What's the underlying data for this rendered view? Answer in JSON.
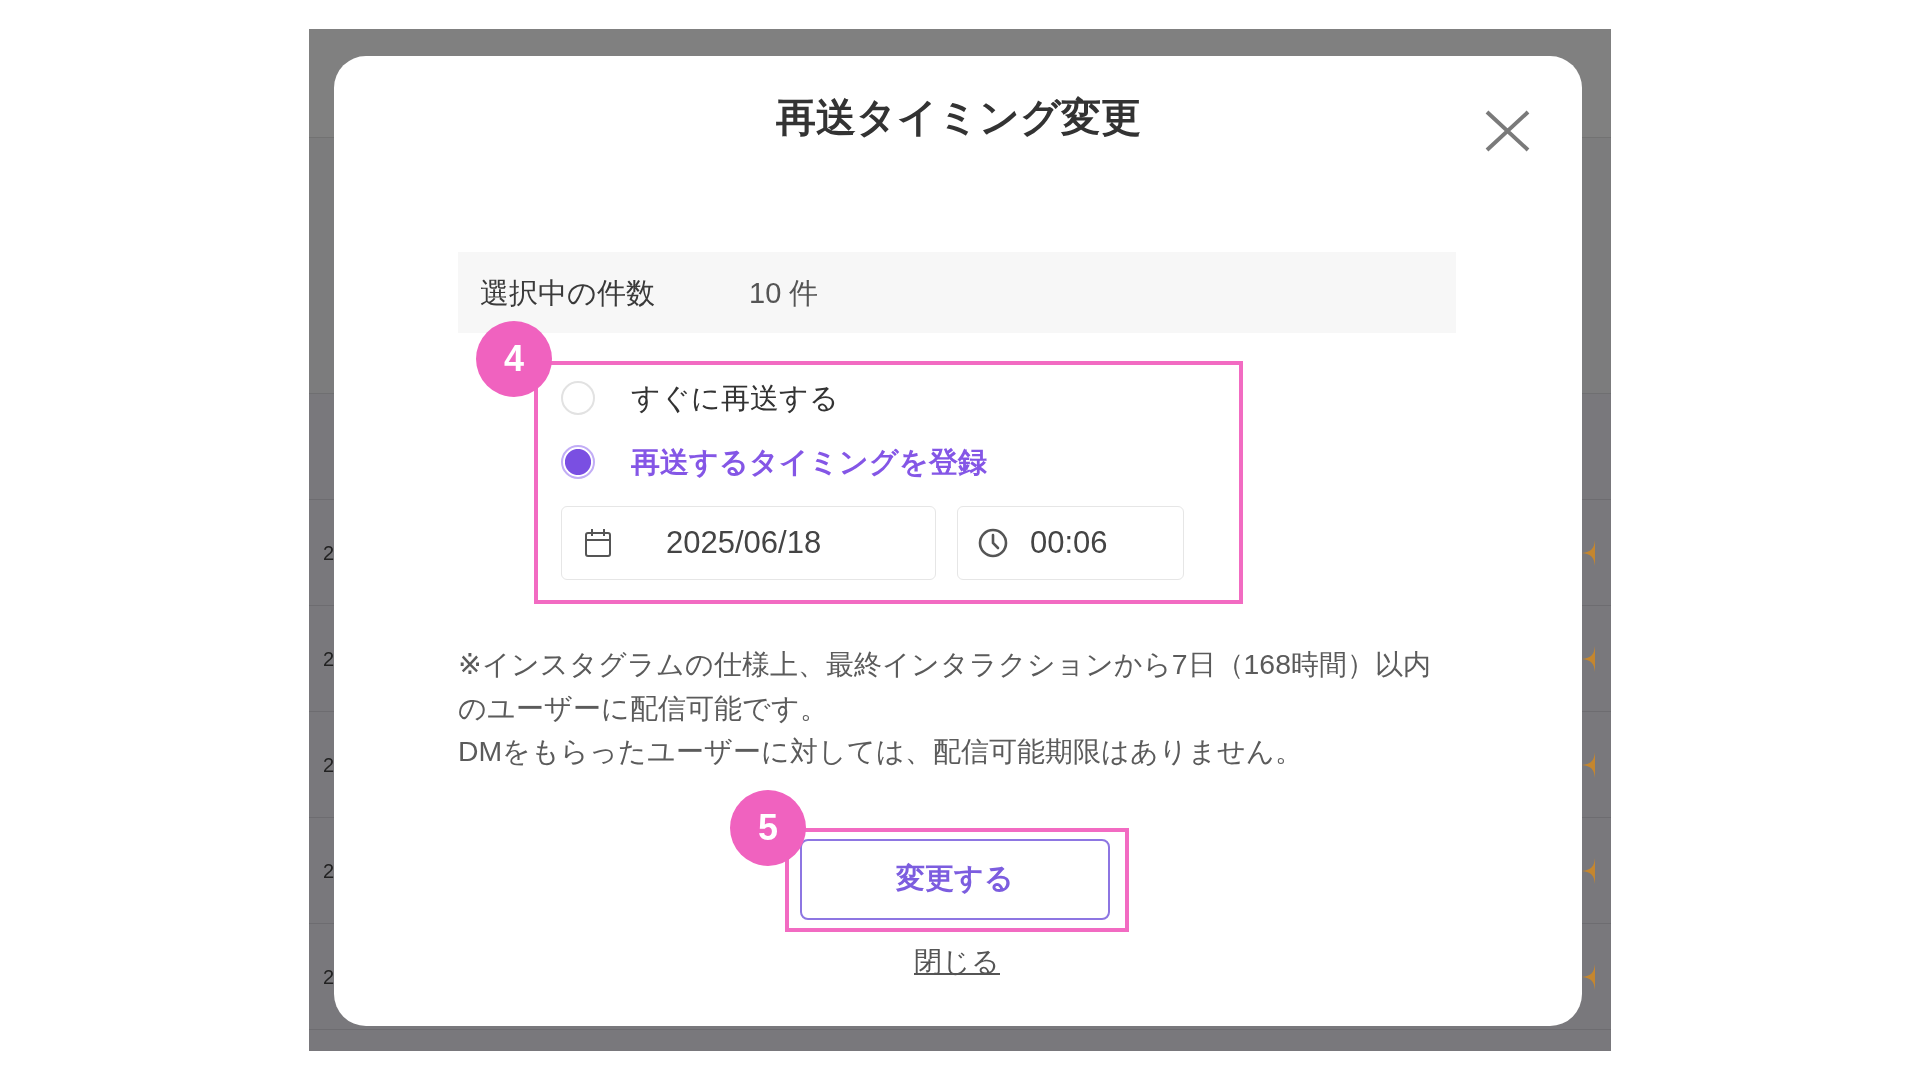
{
  "background_page": {
    "table_rows": [
      {
        "column_1": "2"
      },
      {
        "column_1": "2"
      },
      {
        "column_1": "2"
      },
      {
        "column_1": "2"
      },
      {
        "column_1": "2"
      }
    ]
  },
  "dialog": {
    "title": "再送タイミング変更",
    "selected_count": {
      "label": "選択中の件数",
      "value": "10 件"
    },
    "timing": {
      "callout": "4",
      "options": [
        {
          "label": "すぐに再送する",
          "selected": false
        },
        {
          "label": "再送するタイミングを登録",
          "selected": true
        }
      ],
      "date_field": {
        "value": "2025/06/18"
      },
      "time_field": {
        "value": "00:06"
      }
    },
    "notes": [
      "※インスタグラムの仕様上、最終インタラクションから7日（168時間）以内のユーザーに配信可能です。",
      "DMをもらったユーザーに対しては、配信可能期限はありません。"
    ],
    "submit_button": {
      "label": "変更する",
      "callout": "5"
    },
    "close_link": {
      "label": "閉じる"
    }
  }
}
